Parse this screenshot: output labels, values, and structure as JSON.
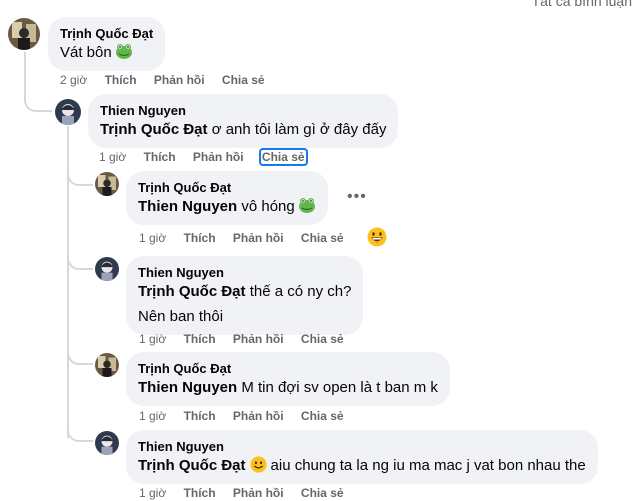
{
  "filter_label": "Tất cả bình luận",
  "comments": [
    {
      "author": "Trịnh Quốc Đạt",
      "mention": "",
      "text": "Vát bôn",
      "time": "2 giờ",
      "like": "Thích",
      "reply": "Phản hồi",
      "share": "Chia sẻ",
      "emoji": "frog-emoji"
    },
    {
      "author": "Thien Nguyen",
      "mention": "Trịnh Quốc Đạt",
      "text": "ơ anh tôi làm gì ở đây đấy",
      "time": "1 giờ",
      "like": "Thích",
      "reply": "Phản hồi",
      "share": "Chia sẻ"
    },
    {
      "author": "Trịnh Quốc Đạt",
      "mention": "Thien Nguyen",
      "text": "vô hóng",
      "time": "1 giờ",
      "like": "Thích",
      "reply": "Phản hồi",
      "share": "Chia sẻ",
      "emoji": "frog-emoji",
      "reaction": "grinning-face-emoji",
      "more": "•••"
    },
    {
      "author": "Thien Nguyen",
      "mention": "Trịnh Quốc Đạt",
      "text": "thế a có ny ch?",
      "text2": "Nên ban thôi",
      "time": "1 giờ",
      "like": "Thích",
      "reply": "Phản hồi",
      "share": "Chia sẻ"
    },
    {
      "author": "Trịnh Quốc Đạt",
      "mention": "Thien Nguyen",
      "text": "M tin đợi sv open là t ban m k",
      "time": "1 giờ",
      "like": "Thích",
      "reply": "Phản hồi",
      "share": "Chia sẻ"
    },
    {
      "author": "Thien Nguyen",
      "mention": "Trịnh Quốc Đạt",
      "text": "aiu chung ta la ng iu ma mac j vat bon nhau the",
      "time": "1 giờ",
      "like": "Thích",
      "reply": "Phản hồi",
      "share": "Chia sẻ",
      "emoji": "slightly-smiling-face-emoji"
    }
  ],
  "colors": {
    "bubble": "#f0f2f5",
    "meta": "#65676b",
    "thread": "#d5d8dc",
    "focus": "#1877f2"
  }
}
